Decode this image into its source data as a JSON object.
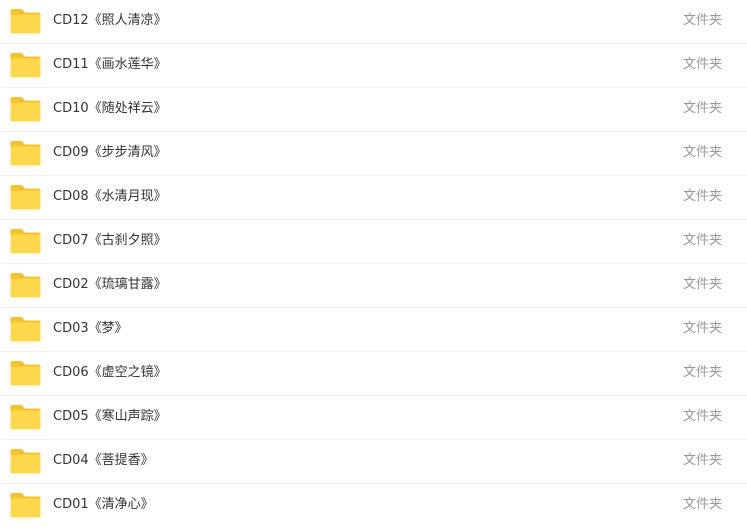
{
  "file_list": {
    "items": [
      {
        "name": "CD12《照人清凉》",
        "type": "文件夹",
        "icon": "folder-icon"
      },
      {
        "name": "CD11《画水莲华》",
        "type": "文件夹",
        "icon": "folder-icon"
      },
      {
        "name": "CD10《随处祥云》",
        "type": "文件夹",
        "icon": "folder-icon"
      },
      {
        "name": "CD09《步步清风》",
        "type": "文件夹",
        "icon": "folder-icon"
      },
      {
        "name": "CD08《水清月现》",
        "type": "文件夹",
        "icon": "folder-icon"
      },
      {
        "name": "CD07《古刹夕照》",
        "type": "文件夹",
        "icon": "folder-icon"
      },
      {
        "name": "CD02《琉璃甘露》",
        "type": "文件夹",
        "icon": "folder-icon"
      },
      {
        "name": "CD03《梦》",
        "type": "文件夹",
        "icon": "folder-icon"
      },
      {
        "name": "CD06《虚空之镜》",
        "type": "文件夹",
        "icon": "folder-icon"
      },
      {
        "name": "CD05《寒山声踪》",
        "type": "文件夹",
        "icon": "folder-icon"
      },
      {
        "name": "CD04《菩提香》",
        "type": "文件夹",
        "icon": "folder-icon"
      },
      {
        "name": "CD01《清净心》",
        "type": "文件夹",
        "icon": "folder-icon"
      }
    ]
  },
  "colors": {
    "folder_body": "#FFD84E",
    "folder_tab": "#F5C22C",
    "name_text": "#333333",
    "type_text": "#999999",
    "divider": "#EEEEEE"
  }
}
